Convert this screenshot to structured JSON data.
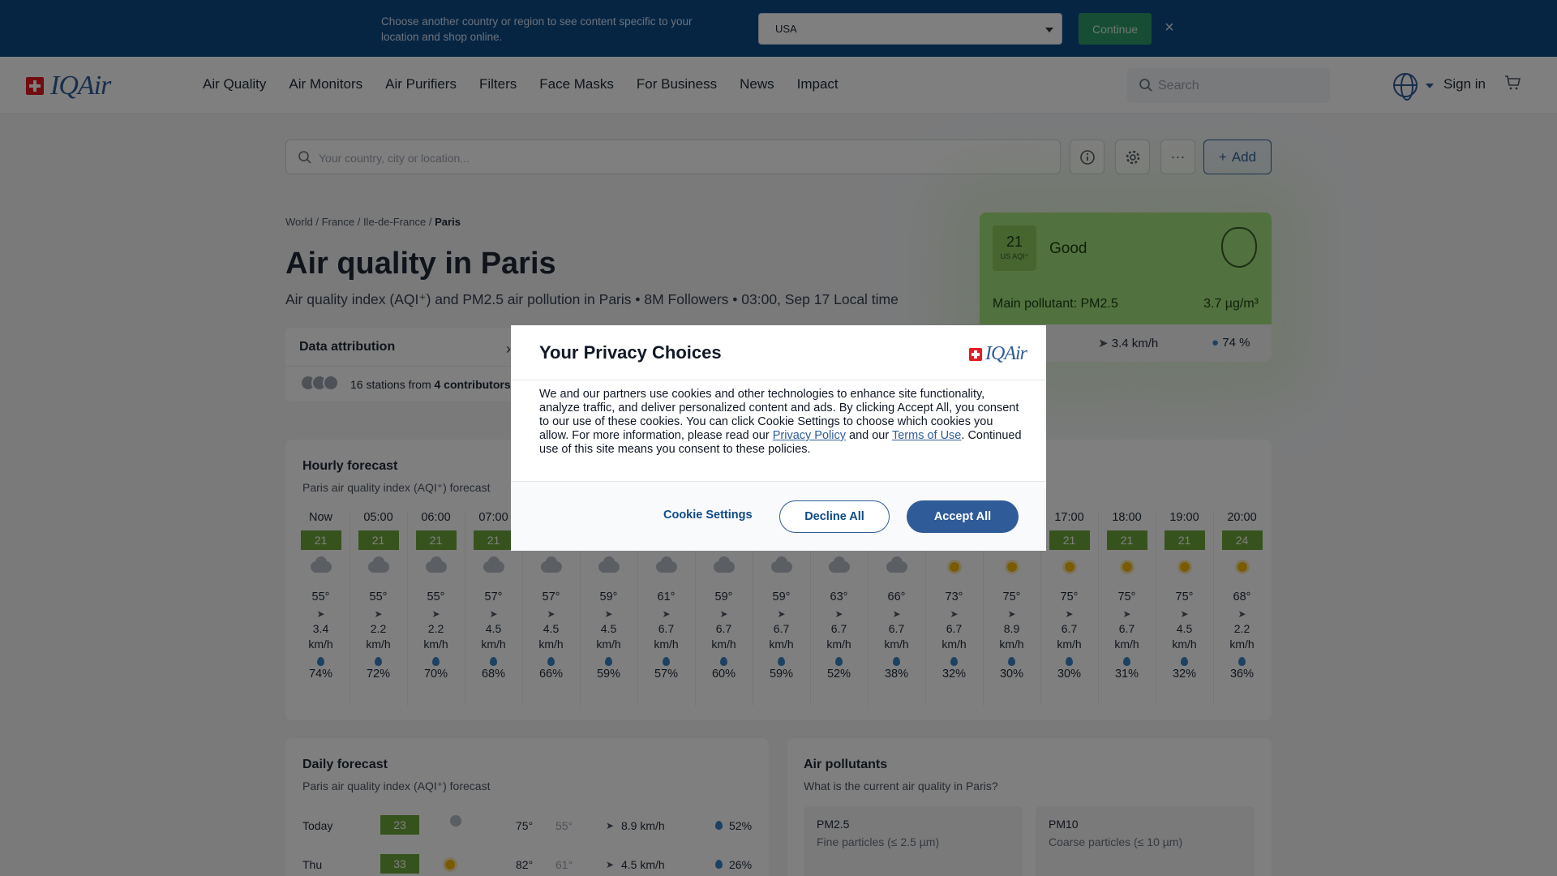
{
  "region_banner": {
    "text": "Choose another country or region to see content specific to your location and shop online.",
    "selected_region": "USA",
    "continue_label": "Continue",
    "close_icon": "close-icon"
  },
  "header": {
    "logo_text": "IQAir",
    "nav": [
      "Air Quality",
      "Air Monitors",
      "Air Purifiers",
      "Filters",
      "Face Masks",
      "For Business",
      "News",
      "Impact"
    ],
    "search_placeholder": "Search",
    "signin_label": "Sign in",
    "icons": [
      "search-icon",
      "globe-icon",
      "cart-icon"
    ]
  },
  "toolbar": {
    "location_placeholder": "Your country, city or location...",
    "add_label": "Add",
    "icons": [
      "info-icon",
      "gear-icon",
      "more-icon",
      "plus-icon"
    ]
  },
  "breadcrumb": {
    "world": "World",
    "country": "France",
    "region": "Ile-de-France",
    "city": "Paris",
    "separator": "/"
  },
  "page": {
    "title": "Air quality in Paris",
    "subtitle": "Air quality index (AQI⁺) and PM2.5 air pollution in Paris • 8M Followers • 03:00, Sep 17 Local time"
  },
  "attribution": {
    "title": "Data attribution",
    "stations_prefix": "16 stations from ",
    "contributors": "4 contributors"
  },
  "aqi_card": {
    "value": "21",
    "unit": "US AQI⁺",
    "status": "Good",
    "main_pollutant_label": "Main pollutant: PM2.5",
    "main_pollutant_value": "3.7 µg/m³",
    "wind": "3.4 km/h",
    "humidity": "74 %",
    "status_color": "#a3e37c"
  },
  "hourly": {
    "title": "Hourly forecast",
    "subtitle": "Paris air quality index (AQI⁺) forecast",
    "columns": [
      {
        "time": "Now",
        "aqi": "21",
        "weather": "cloud",
        "temp": "55°",
        "wind": "3.4",
        "unit": "km/h",
        "hum": "74%"
      },
      {
        "time": "05:00",
        "aqi": "21",
        "weather": "cloud",
        "temp": "55°",
        "wind": "2.2",
        "unit": "km/h",
        "hum": "72%"
      },
      {
        "time": "06:00",
        "aqi": "21",
        "weather": "cloud",
        "temp": "55°",
        "wind": "2.2",
        "unit": "km/h",
        "hum": "70%"
      },
      {
        "time": "07:00",
        "aqi": "21",
        "weather": "cloud",
        "temp": "57°",
        "wind": "4.5",
        "unit": "km/h",
        "hum": "68%"
      },
      {
        "time": "",
        "aqi": "",
        "weather": "cloud",
        "temp": "57°",
        "wind": "4.5",
        "unit": "km/h",
        "hum": "66%"
      },
      {
        "time": "",
        "aqi": "",
        "weather": "cloud",
        "temp": "59°",
        "wind": "4.5",
        "unit": "km/h",
        "hum": "59%"
      },
      {
        "time": "",
        "aqi": "",
        "weather": "cloud",
        "temp": "61°",
        "wind": "6.7",
        "unit": "km/h",
        "hum": "57%"
      },
      {
        "time": "",
        "aqi": "",
        "weather": "cloud",
        "temp": "59°",
        "wind": "6.7",
        "unit": "km/h",
        "hum": "60%"
      },
      {
        "time": "",
        "aqi": "",
        "weather": "cloud",
        "temp": "59°",
        "wind": "6.7",
        "unit": "km/h",
        "hum": "59%"
      },
      {
        "time": "",
        "aqi": "",
        "weather": "cloud",
        "temp": "63°",
        "wind": "6.7",
        "unit": "km/h",
        "hum": "52%"
      },
      {
        "time": "",
        "aqi": "",
        "weather": "cloud",
        "temp": "66°",
        "wind": "6.7",
        "unit": "km/h",
        "hum": "38%"
      },
      {
        "time": "",
        "aqi": "",
        "weather": "sun",
        "temp": "73°",
        "wind": "6.7",
        "unit": "km/h",
        "hum": "32%"
      },
      {
        "time": "",
        "aqi": "",
        "weather": "sun",
        "temp": "75°",
        "wind": "8.9",
        "unit": "km/h",
        "hum": "30%"
      },
      {
        "time": "17:00",
        "aqi": "21",
        "weather": "sun",
        "temp": "75°",
        "wind": "6.7",
        "unit": "km/h",
        "hum": "30%"
      },
      {
        "time": "18:00",
        "aqi": "21",
        "weather": "sun",
        "temp": "75°",
        "wind": "6.7",
        "unit": "km/h",
        "hum": "31%"
      },
      {
        "time": "19:00",
        "aqi": "21",
        "weather": "sun",
        "temp": "75°",
        "wind": "4.5",
        "unit": "km/h",
        "hum": "32%"
      },
      {
        "time": "20:00",
        "aqi": "24",
        "weather": "sun",
        "temp": "68°",
        "wind": "2.2",
        "unit": "km/h",
        "hum": "36%"
      }
    ]
  },
  "daily": {
    "title": "Daily forecast",
    "subtitle": "Paris air quality index (AQI⁺) forecast",
    "rows": [
      {
        "day": "Today",
        "aqi": "23",
        "weather": "cloud",
        "hi": "75°",
        "lo": "55°",
        "wind": "8.9 km/h",
        "hum": "52%"
      },
      {
        "day": "Thu",
        "aqi": "33",
        "weather": "sun",
        "hi": "82°",
        "lo": "61°",
        "wind": "4.5 km/h",
        "hum": "26%"
      }
    ]
  },
  "pollutants": {
    "title": "Air pollutants",
    "subtitle": "What is the current air quality in Paris?",
    "cards": [
      {
        "name": "PM2.5",
        "desc": "Fine particles (≤ 2.5 µm)"
      },
      {
        "name": "PM10",
        "desc": "Coarse particles (≤ 10 µm)"
      }
    ]
  },
  "privacy_modal": {
    "title": "Your Privacy Choices",
    "logo_text": "IQAir",
    "body_1": "We and our partners use cookies and other technologies to enhance site functionality, analyze traffic, and deliver personalized content and ads. By clicking Accept All, you consent to our use of these cookies. You can click Cookie Settings to choose which cookies you allow. For more information, please read our ",
    "privacy_link": "Privacy Policy",
    "body_2": " and our ",
    "terms_link": "Terms of Use",
    "body_3": ". Continued use of this site means you consent to these policies.",
    "cookie_settings_label": "Cookie Settings",
    "decline_label": "Decline All",
    "accept_label": "Accept All"
  }
}
